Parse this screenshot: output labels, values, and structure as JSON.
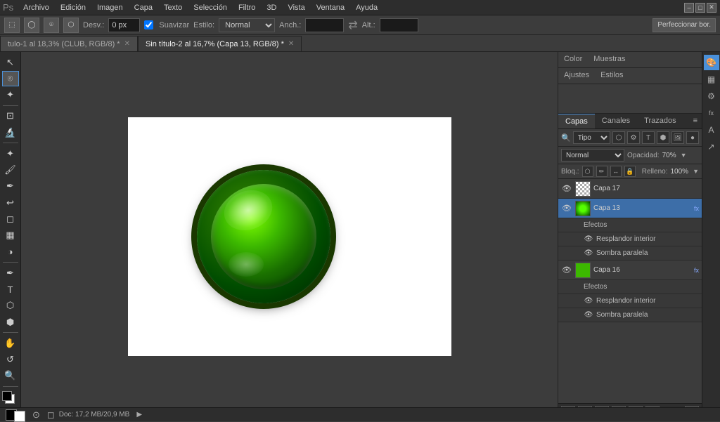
{
  "app": {
    "title": "Adobe Photoshop"
  },
  "menubar": {
    "items": [
      "Archivo",
      "Edición",
      "Imagen",
      "Capa",
      "Texto",
      "Selección",
      "Filtro",
      "3D",
      "Vista",
      "Ventana",
      "Ayuda"
    ],
    "close": "✕",
    "min": "–",
    "max": "□"
  },
  "optionsbar": {
    "desv_label": "Desv.:",
    "desv_value": "0 px",
    "smooth_label": "Suavizar",
    "style_label": "Estilo:",
    "style_value": "Normal",
    "width_label": "Anch.:",
    "height_label": "Alt.:",
    "refine_btn": "Perfeccionar bor."
  },
  "tabs": [
    {
      "label": "tulo-1 al 18,3% (CLUB, RGB/8) *",
      "active": false
    },
    {
      "label": "Sin título-2 al 16,7% (Capa 13, RGB/8) *",
      "active": true
    }
  ],
  "toolbar_tools": [
    "◻",
    "🔲",
    "⬚",
    "✂",
    "↔",
    "⌖",
    "✏",
    "🖌",
    "⬢",
    "🔧",
    "✒",
    "T",
    "🔍",
    "✋",
    "↕"
  ],
  "layers_panel": {
    "tabs": [
      "Capas",
      "Canales",
      "Trazados"
    ],
    "active_tab": "Capas",
    "search_placeholder": "Tipo",
    "blend_mode": "Normal",
    "opacity_label": "Opacidad:",
    "opacity_value": "70%",
    "lock_label": "Bloq.:",
    "fill_label": "Relleno:",
    "fill_value": "100%",
    "layers": [
      {
        "id": "capa17",
        "name": "Capa 17",
        "visible": true,
        "active": false,
        "type": "checker",
        "fx": false
      },
      {
        "id": "capa13",
        "name": "Capa 13",
        "visible": true,
        "active": true,
        "type": "green-orb",
        "fx": true,
        "subs": [
          {
            "name": "Efectos"
          },
          {
            "name": "Resplandor interior",
            "eye": true
          },
          {
            "name": "Sombra paralela",
            "eye": true
          }
        ]
      },
      {
        "id": "capa16",
        "name": "Capa 16",
        "visible": true,
        "active": false,
        "type": "green-fill",
        "fx": true,
        "subs": [
          {
            "name": "Efectos"
          },
          {
            "name": "Resplandor interior",
            "eye": true
          },
          {
            "name": "Sombra paralela",
            "eye": true
          }
        ]
      }
    ],
    "bottom_btns": [
      "🔗",
      "fx",
      "▣",
      "⊙",
      "📁",
      "＋",
      "🗑"
    ]
  },
  "right_tabs": [
    {
      "label": "Color",
      "active": false
    },
    {
      "label": "Muestras",
      "active": false
    },
    {
      "label": "Ajustes",
      "active": false
    },
    {
      "label": "Estilos",
      "active": false
    }
  ],
  "far_right_icons": [
    "🎨",
    "▦",
    "⚙",
    "fx",
    "A",
    "↗"
  ],
  "statusbar": {
    "doc_info": "Doc: 17,2 MB/20,9 MB"
  }
}
